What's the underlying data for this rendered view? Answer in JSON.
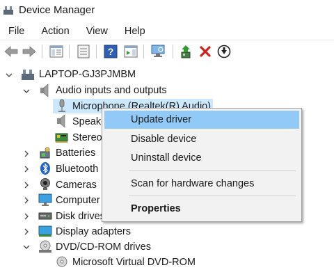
{
  "window": {
    "title": "Device Manager"
  },
  "menu": [
    "File",
    "Action",
    "View",
    "Help"
  ],
  "toolbar": {
    "icons": [
      "back-arrow-icon",
      "forward-arrow-icon",
      "show-hide-console-tree-icon",
      "properties-icon",
      "help-icon",
      "show-hide-action-pane-icon",
      "scan-hardware-icon",
      "update-driver-icon",
      "uninstall-device-icon",
      "disable-device-icon"
    ]
  },
  "tree": {
    "root": "LAPTOP-GJ3PJMBM",
    "audio": "Audio inputs and outputs",
    "microphone": "Microphone (Realtek(R) Audio)",
    "speakers": "Speakers (Realtek(R) Audio)",
    "stereo": "Stereo Mix (Realtek(R) Audio)",
    "batteries": "Batteries",
    "bluetooth": "Bluetooth",
    "cameras": "Cameras",
    "computer": "Computer",
    "disk": "Disk drives",
    "display": "Display adapters",
    "dvd": "DVD/CD-ROM drives",
    "dvd_child": "Microsoft Virtual DVD-ROM"
  },
  "context_menu": {
    "update": "Update driver",
    "disable": "Disable device",
    "uninstall": "Uninstall device",
    "scan": "Scan for hardware changes",
    "properties": "Properties"
  }
}
